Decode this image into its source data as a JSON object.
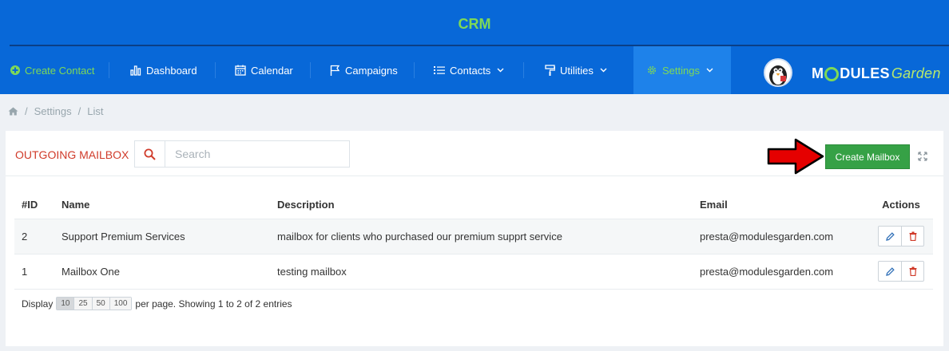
{
  "app": {
    "title": "CRM"
  },
  "nav": {
    "items": [
      {
        "label": "Create Contact",
        "icon": "plus-circle-icon"
      },
      {
        "label": "Dashboard",
        "icon": "bar-chart-icon"
      },
      {
        "label": "Calendar",
        "icon": "calendar-icon"
      },
      {
        "label": "Campaigns",
        "icon": "flag-icon"
      },
      {
        "label": "Contacts",
        "icon": "list-icon"
      },
      {
        "label": "Utilities",
        "icon": "paint-roller-icon"
      },
      {
        "label": "Settings",
        "icon": "gear-icon"
      }
    ]
  },
  "brand": {
    "logo_part1": "M",
    "logo_part2": "DULES",
    "logo_part3": "Garden"
  },
  "breadcrumb": {
    "items": [
      "Settings",
      "List"
    ]
  },
  "panel": {
    "title": "Outgoing Mailbox",
    "search": {
      "placeholder": "Search",
      "value": ""
    },
    "create_button": "Create Mailbox"
  },
  "table": {
    "columns": [
      "#ID",
      "Name",
      "Description",
      "Email",
      "Actions"
    ],
    "rows": [
      {
        "id": "2",
        "name": "Support Premium Services",
        "description": "mailbox for clients who purchased our premium supprt service",
        "email": "presta@modulesgarden.com"
      },
      {
        "id": "1",
        "name": "Mailbox One",
        "description": "testing mailbox",
        "email": "presta@modulesgarden.com"
      }
    ]
  },
  "footer": {
    "display_label": "Display",
    "page_sizes": [
      "10",
      "25",
      "50",
      "100"
    ],
    "selected_page_size": "10",
    "summary": "per page. Showing 1 to 2 of 2 entries"
  },
  "colors": {
    "header_bg": "#0868d8",
    "accent_green": "#7ed957",
    "title_red": "#d03b2a",
    "create_button_bg": "#36a146"
  }
}
